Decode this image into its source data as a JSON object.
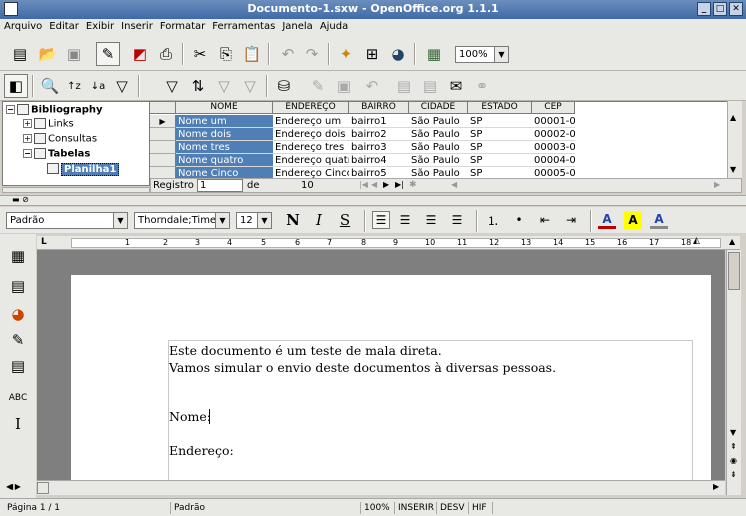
{
  "window": {
    "title": "Documento-1.sxw - OpenOffice.org 1.1.1"
  },
  "menu": [
    "Arquivo",
    "Editar",
    "Exibir",
    "Inserir",
    "Formatar",
    "Ferramentas",
    "Janela",
    "Ajuda"
  ],
  "toolbar": {
    "zoom": "100%"
  },
  "tree": {
    "items": [
      {
        "label": "Bibliography",
        "bold": true
      },
      {
        "label": "Links",
        "bold": false
      },
      {
        "label": "Consultas",
        "bold": false
      },
      {
        "label": "Tabelas",
        "bold": true
      },
      {
        "label": "Planilha1",
        "bold": true
      }
    ]
  },
  "grid": {
    "columns": [
      "NOME",
      "ENDEREÇO",
      "BAIRRO",
      "CIDADE",
      "ESTADO",
      "CEP"
    ],
    "rows": [
      [
        "Nome um",
        "Endereço um",
        "bairro1",
        "São Paulo",
        "SP",
        "00001-0"
      ],
      [
        "Nome dois",
        "Endereço dois",
        "bairro2",
        "São Paulo",
        "SP",
        "00002-0"
      ],
      [
        "Nome tres",
        "Endereço tres",
        "bairro3",
        "São Paulo",
        "SP",
        "00003-0"
      ],
      [
        "Nome quatro",
        "Endereço quatr",
        "bairro4",
        "São Paulo",
        "SP",
        "00004-0"
      ],
      [
        "Nome Cinco",
        "Endereço Cincc",
        "bairro5",
        "São Paulo",
        "SP",
        "00005-0"
      ]
    ],
    "nav": {
      "record_label": "Registro",
      "record": "1",
      "of_label": "de",
      "total": "10"
    }
  },
  "format": {
    "style": "Padrão",
    "font": "Thorndale;Times",
    "size": "12",
    "bold": "N",
    "italic": "I",
    "underline": "S"
  },
  "ruler": {
    "ticks": [
      "1",
      "2",
      "3",
      "4",
      "5",
      "6",
      "7",
      "8",
      "9",
      "10",
      "11",
      "12",
      "13",
      "14",
      "15",
      "16",
      "17",
      "18"
    ]
  },
  "document": {
    "lines": [
      "Este documento é um teste de mala direta.",
      "Vamos simular o envio deste documentos à diversas pessoas.",
      "Nome:",
      "Endereço:"
    ]
  },
  "status": {
    "page": "Página 1 / 1",
    "style": "Padrão",
    "zoom": "100%",
    "insert": "INSERIR",
    "sel": "DESV",
    "hyperlink": "HIF"
  },
  "colors": {
    "selection": "#4f7fb5",
    "titlebar": "#3f6aa8"
  }
}
